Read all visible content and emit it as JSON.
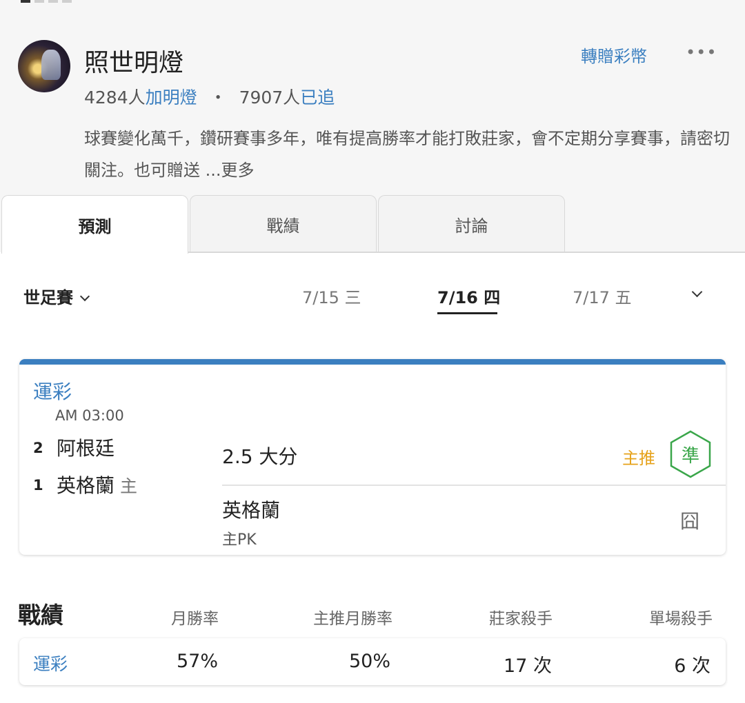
{
  "profile": {
    "name": "照世明燈",
    "lamp_count": "4284人",
    "lamp_label": "加明燈",
    "separator": "・",
    "follow_count": "7907人",
    "follow_label": "已追",
    "transfer_label": "轉贈彩幣",
    "more_label": "•••",
    "description": "球賽變化萬千，鑽研賽事多年，唯有提高勝率才能打敗莊家，會不定期分享賽事，請密切關注。也可贈送 ...更多"
  },
  "tabs": [
    {
      "label": "預測",
      "active": true
    },
    {
      "label": "戰績",
      "active": false
    },
    {
      "label": "討論",
      "active": false
    }
  ],
  "filter": {
    "league": "世足賽",
    "dates": [
      "7/15 三",
      "7/16 四",
      "7/17 五"
    ],
    "active_date": "7/16 四"
  },
  "match": {
    "category": "運彩",
    "time": "AM 03:00",
    "teams": [
      {
        "rank": "2",
        "name": "阿根廷",
        "home": ""
      },
      {
        "rank": "1",
        "name": "英格蘭",
        "home": "主"
      }
    ],
    "pick1": "2.5 大分",
    "pick1_badge": "主推",
    "pick1_mark": "準",
    "pick2": "英格蘭",
    "pick2_sub": "主PK",
    "pick2_mark": "囧",
    "accent_color": "#3b7fc0",
    "badge_color": "#e6a21a",
    "hex_color": "#3aa64a"
  },
  "record": {
    "title": "戰績",
    "headers": [
      "月勝率",
      "主推月勝率",
      "莊家殺手",
      "單場殺手"
    ],
    "row": {
      "category": "運彩",
      "values": [
        "57%",
        "50%",
        "17 次",
        "6 次"
      ]
    }
  }
}
